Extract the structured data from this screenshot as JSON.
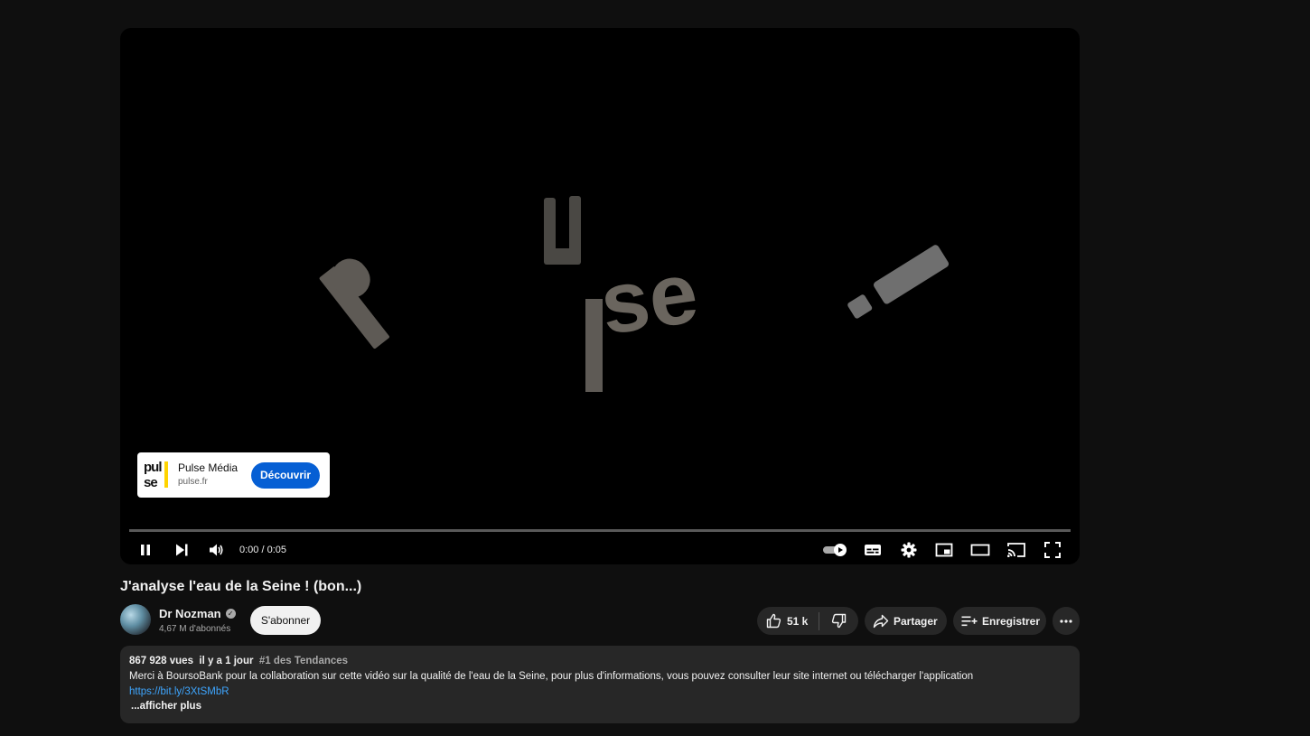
{
  "player": {
    "time_display": "0:00 / 0:05",
    "progress_fraction": 0.0,
    "autoplay_on": true,
    "ad": {
      "name": "Pulse Média",
      "domain": "pulse.fr",
      "cta_label": "Découvrir",
      "logo_line1": "pul",
      "logo_line2": "se",
      "cta_color": "#065fd4"
    },
    "controls": {
      "left": [
        "pause-icon",
        "next-icon",
        "volume-icon"
      ],
      "right": [
        "autoplay-toggle-icon",
        "subtitles-icon",
        "settings-gear-icon",
        "miniplayer-icon",
        "theater-mode-icon",
        "cast-icon",
        "fullscreen-icon"
      ]
    }
  },
  "video": {
    "title": "J'analyse l'eau de la Seine ! (bon...)",
    "channel": {
      "name": "Dr Nozman",
      "verified": true,
      "subscribers": "4,67 M d'abonnés",
      "subscribe_label": "S'abonner"
    },
    "actions": {
      "likes": "51 k",
      "share_label": "Partager",
      "save_label": "Enregistrer"
    },
    "description": {
      "views": "867 928 vues",
      "age": "il y a 1 jour",
      "trending": "#1 des Tendances",
      "text": "Merci à BoursoBank pour la collaboration sur cette vidéo sur la qualité de l'eau de la Seine, pour plus d'informations, vous pouvez consulter leur site internet ou télécharger l'application",
      "link": "https://bit.ly/3XtSMbR",
      "show_more": "...afficher plus"
    }
  }
}
